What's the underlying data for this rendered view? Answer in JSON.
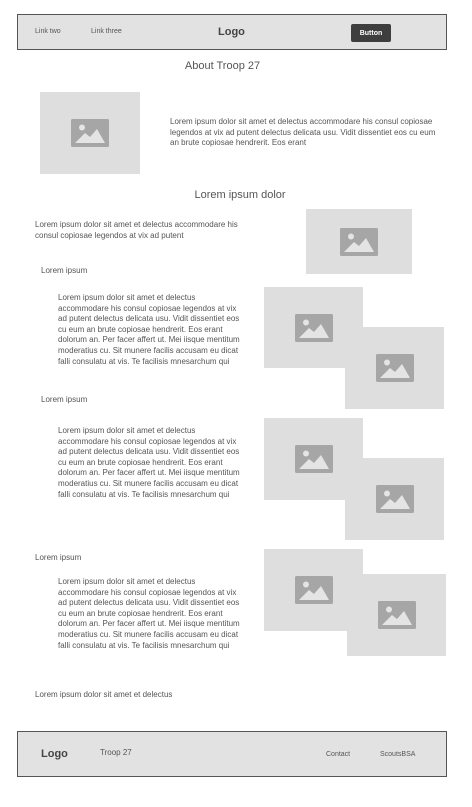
{
  "nav": {
    "links": [
      "Link two",
      "Link three"
    ],
    "logo": "Logo",
    "button_label": "Button"
  },
  "about": {
    "title": "About Troop 27",
    "text": "Lorem ipsum dolor sit amet et delectus accommodare his consul copiosae legendos at vix ad putent delectus delicata usu. Vidit dissentiet eos cu eum an brute copiosae hendrerit. Eos erant"
  },
  "section": {
    "title": "Lorem ipsum dolor",
    "intro": "Lorem ipsum dolor sit amet et delectus accommodare his consul copiosae legendos at vix ad putent",
    "items": [
      {
        "label": "Lorem ipsum",
        "text": "Lorem ipsum dolor sit amet et delectus accommodare his consul copiosae legendos at vix ad putent delectus delicata usu. Vidit dissentiet eos cu eum an brute copiosae hendrerit. Eos erant dolorum an. Per facer affert ut. Mei iisque mentitum moderatius cu. Sit munere facilis accusam eu dicat falli consulatu at vis. Te facilisis mnesarchum qui"
      },
      {
        "label": "Lorem ipsum",
        "text": "Lorem ipsum dolor sit amet et delectus accommodare his consul copiosae legendos at vix ad putent delectus delicata usu. Vidit dissentiet eos cu eum an brute copiosae hendrerit. Eos erant dolorum an. Per facer affert ut. Mei iisque mentitum moderatius cu. Sit munere facilis accusam eu dicat falli consulatu at vis. Te facilisis mnesarchum qui"
      },
      {
        "label": "Lorem ipsum",
        "text": "Lorem ipsum dolor sit amet et delectus accommodare his consul copiosae legendos at vix ad putent delectus delicata usu. Vidit dissentiet eos cu eum an brute copiosae hendrerit. Eos erant dolorum an. Per facer affert ut. Mei iisque mentitum moderatius cu. Sit munere facilis accusam eu dicat falli consulatu at vis. Te facilisis mnesarchum qui"
      }
    ],
    "closing": "Lorem ipsum dolor sit amet et delectus"
  },
  "footer": {
    "logo": "Logo",
    "troop": "Troop 27",
    "links": [
      "Contact",
      "ScoutsBSA"
    ]
  },
  "icons": {
    "placeholder": "image-placeholder-icon"
  },
  "colors": {
    "placeholder_bg": "#dedede",
    "placeholder_icon": "#a6a6a6",
    "bar_bg": "#e2e2e2",
    "button_bg": "#3e3e3e"
  }
}
